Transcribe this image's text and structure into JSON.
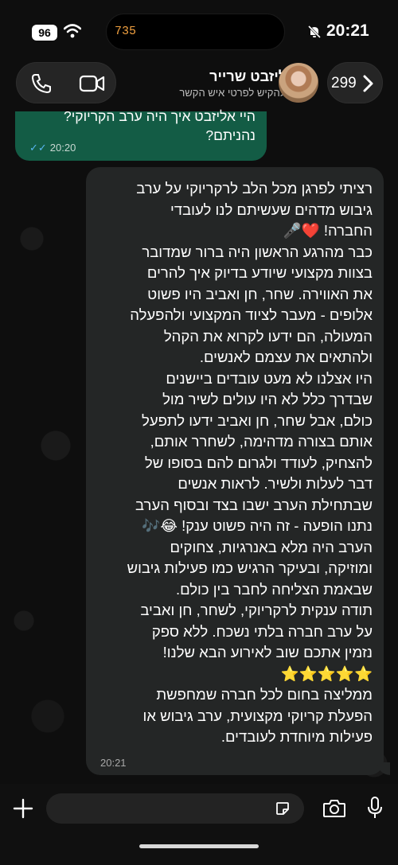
{
  "status_bar": {
    "battery": "96",
    "island_number": "735",
    "time": "20:21"
  },
  "header": {
    "back_count": "299",
    "contact_name": "אליזבט שרייר",
    "contact_subtitle": "יך להקיש לפרטי איש הקשר"
  },
  "outgoing": {
    "lines": [
      "היי אליזבט איך היה ערב הקריוקי?",
      "נהניתם?"
    ],
    "time": "20:20"
  },
  "incoming": {
    "lines": [
      "רציתי לפרגן מכל הלב לרקריוקי על ערב",
      "גיבוש מדהים שעשיתם לנו לעובדי",
      "החברה! ❤️🎤",
      "כבר מהרגע הראשון היה ברור שמדובר",
      "בצוות מקצועי שיודע בדיוק איך להרים",
      "את האווירה. שחר, חן ואביב היו פשוט",
      "אלופים - מעבר לציוד המקצועי ולהפעלה",
      "המעולה, הם ידעו לקרוא את הקהל",
      "ולהתאים את עצמם לאנשים.",
      "היו אצלנו לא מעט עובדים ביישנים",
      "שבדרך כלל לא היו עולים לשיר מול",
      "כולם, אבל שחר, חן ואביב ידעו לתפעל",
      "אותם בצורה מדהימה, לשחרר אותם,",
      "להצחיק, לעודד ולגרום להם בסופו של",
      "דבר לעלות ולשיר. לראות אנשים",
      "שבתחילת הערב ישבו בצד ובסוף הערב",
      "נתנו הופעה - זה היה פשוט ענק! 😂🎶",
      "הערב היה מלא באנרגיות, צחוקים",
      "ומוזיקה, ובעיקר הרגיש כמו פעילות גיבוש",
      "שבאמת הצליחה לחבר בין כולם.",
      "תודה ענקית לרקריוקי, לשחר, חן ואביב",
      "על ערב חברה בלתי נשכח. ללא ספק",
      "נזמין אתכם שוב לאירוע הבא שלנו!",
      "⭐⭐⭐⭐⭐",
      "ממליצה בחום לכל חברה שמחפשת",
      "הפעלת קריוקי מקצועית, ערב גיבוש או",
      "פעילות מיוחדת לעובדים."
    ],
    "time": "20:21"
  },
  "icons": {
    "back": "chevron-left-icon",
    "voice_call": "phone-icon",
    "video_call": "video-camera-icon",
    "attach": "plus-icon",
    "sticker": "sticker-icon",
    "camera": "camera-icon",
    "mic": "microphone-icon"
  },
  "colors": {
    "outgoing_bubble": "#135c45",
    "incoming_bubble": "#242626",
    "read_ticks": "#58b6f0",
    "island_number": "#f0a040"
  }
}
